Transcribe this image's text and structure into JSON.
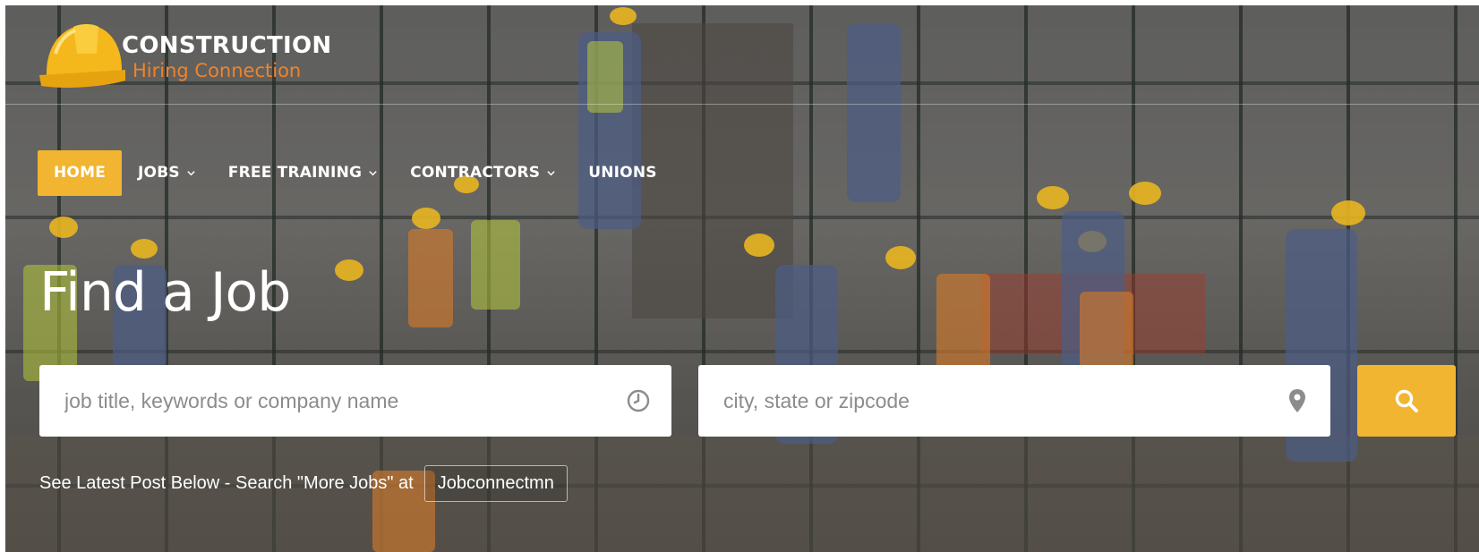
{
  "logo": {
    "line1": "CONSTRUCTION",
    "line2": "Hiring Connection",
    "icon": "hard-hat-icon"
  },
  "nav": {
    "items": [
      {
        "label": "HOME",
        "active": true,
        "dropdown": false
      },
      {
        "label": "JOBS",
        "active": false,
        "dropdown": true
      },
      {
        "label": "FREE TRAINING",
        "active": false,
        "dropdown": true
      },
      {
        "label": "CONTRACTORS",
        "active": false,
        "dropdown": true
      },
      {
        "label": "UNIONS",
        "active": false,
        "dropdown": false
      }
    ]
  },
  "hero": {
    "title": "Find a Job"
  },
  "search": {
    "keyword_placeholder": "job title, keywords or company name",
    "keyword_value": "",
    "keyword_icon": "clock-icon",
    "location_placeholder": "city, state or zipcode",
    "location_value": "",
    "location_icon": "map-pin-icon",
    "button_icon": "search-icon"
  },
  "latest": {
    "text": "See Latest Post Below - Search \"More Jobs\" at",
    "link_label": "Jobconnectmn"
  },
  "colors": {
    "accent": "#f2b531",
    "logo_orange": "#f0832a",
    "text_light": "#ffffff"
  }
}
